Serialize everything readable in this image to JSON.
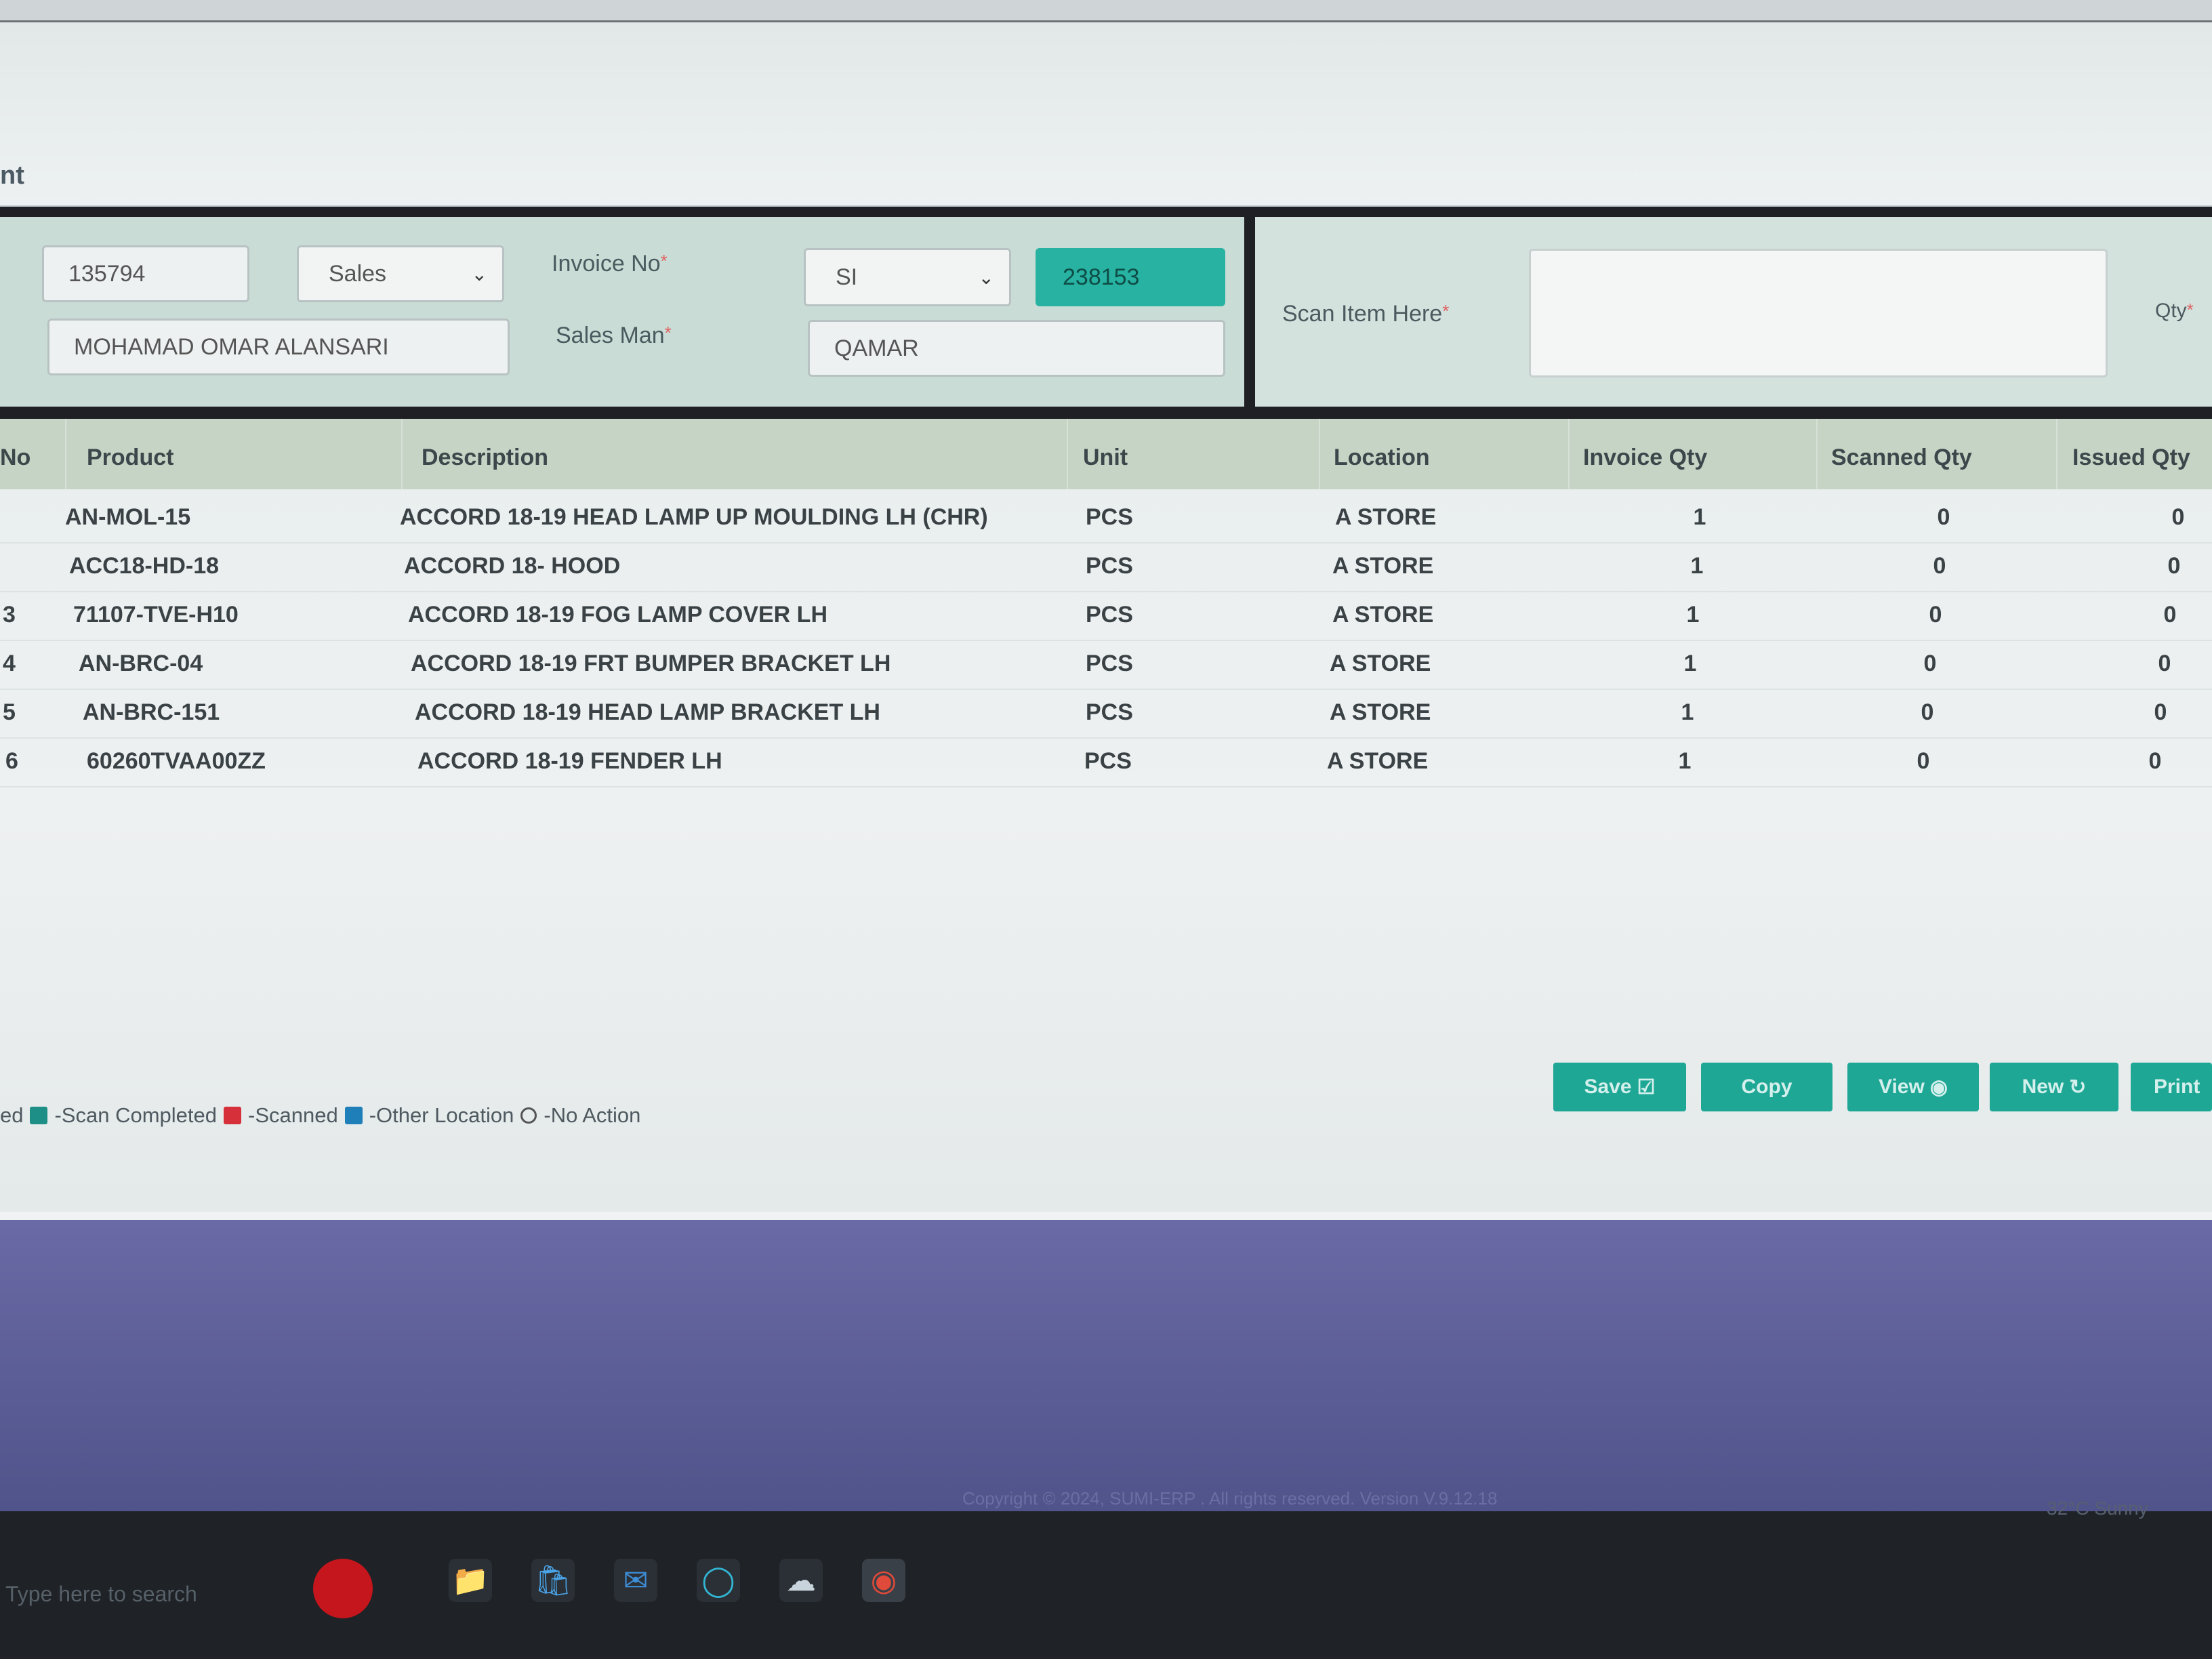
{
  "page": {
    "title_fragment": "nt"
  },
  "form": {
    "customer_code": "135794",
    "customer_name": "MOHAMAD OMAR ALANSARI",
    "sale_type": "Sales",
    "invoice_no_label": "Invoice No",
    "invoice_prefix": "SI",
    "invoice_number": "238153",
    "sales_man_label": "Sales Man",
    "sales_man": "QAMAR",
    "required_mark": "*",
    "scan_label": "Scan Item Here",
    "qty_label": "Qty"
  },
  "table": {
    "columns": [
      "No",
      "Product",
      "Description",
      "Unit",
      "Location",
      "Invoice Qty",
      "Scanned Qty",
      "Issued Qty"
    ],
    "rows": [
      {
        "no": "",
        "product": "AN-MOL-15",
        "description": "ACCORD 18-19 HEAD LAMP UP MOULDING LH (CHR)",
        "unit": "PCS",
        "location": "A STORE",
        "invoice_qty": "1",
        "scanned_qty": "0",
        "issued_qty": "0"
      },
      {
        "no": "",
        "product": "ACC18-HD-18",
        "description": "ACCORD 18- HOOD",
        "unit": "PCS",
        "location": "A STORE",
        "invoice_qty": "1",
        "scanned_qty": "0",
        "issued_qty": "0"
      },
      {
        "no": "3",
        "product": "71107-TVE-H10",
        "description": "ACCORD 18-19 FOG LAMP COVER LH",
        "unit": "PCS",
        "location": "A STORE",
        "invoice_qty": "1",
        "scanned_qty": "0",
        "issued_qty": "0"
      },
      {
        "no": "4",
        "product": "AN-BRC-04",
        "description": "ACCORD 18-19 FRT BUMPER BRACKET LH",
        "unit": "PCS",
        "location": "A STORE",
        "invoice_qty": "1",
        "scanned_qty": "0",
        "issued_qty": "0"
      },
      {
        "no": "5",
        "product": "AN-BRC-151",
        "description": "ACCORD 18-19 HEAD LAMP BRACKET LH",
        "unit": "PCS",
        "location": "A STORE",
        "invoice_qty": "1",
        "scanned_qty": "0",
        "issued_qty": "0"
      },
      {
        "no": "6",
        "product": "60260TVAA00ZZ",
        "description": "ACCORD 18-19 FENDER LH",
        "unit": "PCS",
        "location": "A STORE",
        "invoice_qty": "1",
        "scanned_qty": "0",
        "issued_qty": "0"
      }
    ]
  },
  "legend": {
    "prefix": "ed",
    "scan_completed": "-Scan Completed",
    "scanned": "-Scanned",
    "other_location": "-Other Location",
    "no_action": "-No Action",
    "colors": {
      "completed": "#1d8f86",
      "scanned": "#d6303a",
      "other": "#1f7fb8"
    }
  },
  "buttons": {
    "save": "Save",
    "copy": "Copy",
    "view": "View",
    "new": "New",
    "print": "Print"
  },
  "footer": {
    "copyright": "Copyright © 2024, SUMI-ERP . All rights reserved. Version V.9.12.18"
  },
  "taskbar": {
    "search_placeholder": "Type here to search",
    "weather": "32°C Sunny",
    "icons": [
      "file-explorer-icon",
      "store-icon",
      "mail-icon",
      "edge-icon",
      "app-icon",
      "chrome-icon"
    ]
  },
  "colors": {
    "accent": "#27b2a2",
    "form_bg": "#c9ddd6",
    "table_header_bg": "#c5d4c5"
  }
}
